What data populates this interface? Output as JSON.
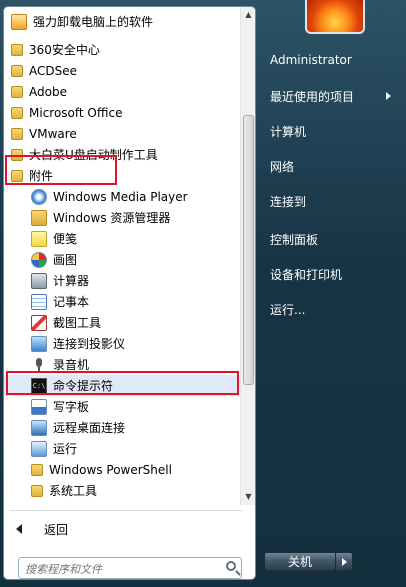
{
  "programs": [
    {
      "label": "强力卸载电脑上的软件",
      "icon": "uninstall-icon",
      "level": 0
    },
    {
      "label": "360安全中心",
      "icon": "folder-icon",
      "level": 0
    },
    {
      "label": "ACDSee",
      "icon": "folder-icon",
      "level": 0
    },
    {
      "label": "Adobe",
      "icon": "folder-icon",
      "level": 0
    },
    {
      "label": "Microsoft Office",
      "icon": "folder-icon",
      "level": 0
    },
    {
      "label": "VMware",
      "icon": "folder-icon",
      "level": 0
    },
    {
      "label": "大白菜U盘启动制作工具",
      "icon": "folder-icon",
      "level": 0
    },
    {
      "label": "附件",
      "icon": "folder-icon",
      "level": 0
    },
    {
      "label": "Windows Media Player",
      "icon": "media-player-icon",
      "level": 1
    },
    {
      "label": "Windows 资源管理器",
      "icon": "explorer-icon",
      "level": 1
    },
    {
      "label": "便笺",
      "icon": "sticky-notes-icon",
      "level": 1
    },
    {
      "label": "画图",
      "icon": "paint-icon",
      "level": 1
    },
    {
      "label": "计算器",
      "icon": "calculator-icon",
      "level": 1
    },
    {
      "label": "记事本",
      "icon": "notepad-icon",
      "level": 1
    },
    {
      "label": "截图工具",
      "icon": "snipping-tool-icon",
      "level": 1
    },
    {
      "label": "连接到投影仪",
      "icon": "projector-icon",
      "level": 1
    },
    {
      "label": "录音机",
      "icon": "microphone-icon",
      "level": 1
    },
    {
      "label": "命令提示符",
      "icon": "command-prompt-icon",
      "level": 1
    },
    {
      "label": "写字板",
      "icon": "wordpad-icon",
      "level": 1
    },
    {
      "label": "远程桌面连接",
      "icon": "remote-desktop-icon",
      "level": 1
    },
    {
      "label": "运行",
      "icon": "run-icon",
      "level": 1
    },
    {
      "label": "Windows PowerShell",
      "icon": "folder-icon",
      "level": 1
    },
    {
      "label": "系统工具",
      "icon": "folder-icon",
      "level": 1
    }
  ],
  "back_label": "返回",
  "search": {
    "placeholder": "搜索程序和文件"
  },
  "right_items": [
    {
      "label": "Administrator"
    },
    {
      "label": "最近使用的项目",
      "has_submenu": true
    },
    {
      "label": "计算机"
    },
    {
      "label": "网络"
    },
    {
      "label": "连接到"
    },
    {
      "label": "控制面板"
    },
    {
      "label": "设备和打印机"
    },
    {
      "label": "运行..."
    }
  ],
  "shutdown_label": "关机",
  "highlight_color": "#e0132b"
}
